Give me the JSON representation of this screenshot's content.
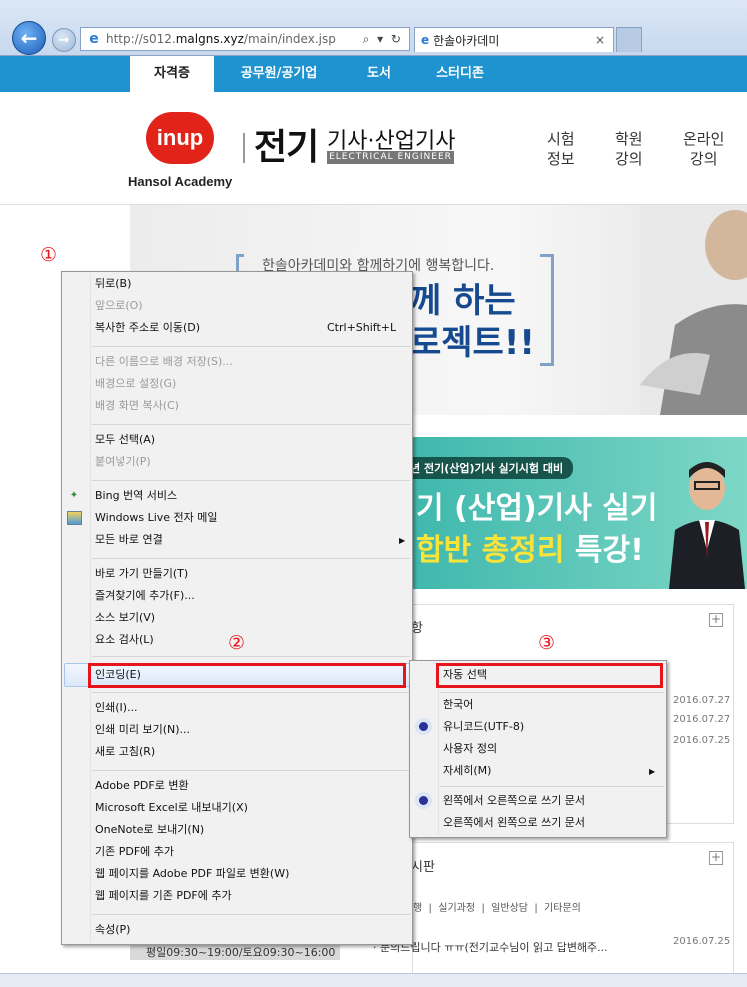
{
  "browser": {
    "url_prefix": "http://s012.",
    "url_domain": "malgns.xyz",
    "url_suffix": "/main/index.jsp",
    "address_tools": "⌕ ▾ ↻",
    "tab_title": "한솔아카데미",
    "tab_close": "×",
    "back_icon": "←",
    "forward_icon": "→",
    "ie_icon": "e"
  },
  "site": {
    "top_nav": [
      "자격증",
      "공무원/공기업",
      "도서",
      "스터디존"
    ],
    "logo": "inup",
    "logo_sub": "Hansol Academy",
    "brand_main": "전기",
    "brand_rest": "기사·산업기사",
    "brand_eng": "ELECTRICAL ENGINEER",
    "main_nav": [
      {
        "l1": "시험",
        "l2": "정보"
      },
      {
        "l1": "학원",
        "l2": "강의"
      },
      {
        "l1": "온라인",
        "l2": "강의"
      }
    ],
    "hero_sub": "한솔아카데미와 함께하기에 행복합니다.",
    "hero_line1": "께 하는",
    "hero_line2": "로젝트!!",
    "banner_pill": "년 전기(산업)기사 실기시험 대비",
    "banner_line1": "기 (산업)기사 실기",
    "banner_line2a": "합반 총정리",
    "banner_line2b": " 특강!",
    "panel1_title": "항",
    "panel1_dates": [
      "2016.07.27",
      "2016.07.27",
      "2016.07.25"
    ],
    "panel2_title": "시판",
    "panel2_tabs": "행  |  실기과정  |  일반상담  |  기타문의",
    "panel2_row": "· 문의드립니다 ㅠㅠ(전기교수님이 읽고 답변해주...",
    "panel2_row_date": "2016.07.25",
    "footer_hours": "평일09:30~19:00/토요09:30~16:00",
    "plus": "+"
  },
  "context_menu": {
    "items": [
      {
        "label": "뒤로(B)",
        "disabled": false
      },
      {
        "label": "앞으로(O)",
        "disabled": true
      },
      {
        "label": "복사한 주소로 이동(D)",
        "disabled": false,
        "shortcut": "Ctrl+Shift+L"
      },
      {
        "label": "다른 이름으로 배경 저장(S)...",
        "disabled": true
      },
      {
        "label": "배경으로 설정(G)",
        "disabled": true
      },
      {
        "label": "배경 화면 복사(C)",
        "disabled": true
      },
      {
        "label": "모두 선택(A)",
        "disabled": false
      },
      {
        "label": "붙여넣기(P)",
        "disabled": true
      },
      {
        "label": "Bing 번역 서비스",
        "disabled": false
      },
      {
        "label": "Windows Live 전자 메일",
        "disabled": false
      },
      {
        "label": "모든 바로 연결",
        "disabled": false
      },
      {
        "label": "바로 가기 만들기(T)",
        "disabled": false
      },
      {
        "label": "즐겨찾기에 추가(F)...",
        "disabled": false
      },
      {
        "label": "소스 보기(V)",
        "disabled": false
      },
      {
        "label": "요소 검사(L)",
        "disabled": false
      },
      {
        "label": "인코딩(E)",
        "disabled": false
      },
      {
        "label": "인쇄(I)...",
        "disabled": false
      },
      {
        "label": "인쇄 미리 보기(N)...",
        "disabled": false
      },
      {
        "label": "새로 고침(R)",
        "disabled": false
      },
      {
        "label": "Adobe PDF로 변환",
        "disabled": false
      },
      {
        "label": "Microsoft Excel로 내보내기(X)",
        "disabled": false
      },
      {
        "label": "OneNote로 보내기(N)",
        "disabled": false
      },
      {
        "label": "기존 PDF에 추가",
        "disabled": false
      },
      {
        "label": "웹 페이지를 Adobe PDF 파일로 변환(W)",
        "disabled": false
      },
      {
        "label": "웹 페이지를 기존 PDF에 추가",
        "disabled": false
      },
      {
        "label": "속성(P)",
        "disabled": false
      }
    ],
    "submenu_arrow": "▶"
  },
  "encoding_submenu": {
    "items": [
      {
        "label": "자동 선택"
      },
      {
        "label": "한국어"
      },
      {
        "label": "유니코드(UTF-8)",
        "checked": true
      },
      {
        "label": "사용자 정의"
      },
      {
        "label": "자세히(M)"
      },
      {
        "label": "왼쪽에서 오른쪽으로 쓰기 문서",
        "checked": true
      },
      {
        "label": "오른쪽에서 왼쪽으로 쓰기 문서"
      }
    ]
  },
  "annotations": {
    "step1": "①",
    "step2": "②",
    "step3": "③",
    "highlight_color": "#e8141c"
  }
}
